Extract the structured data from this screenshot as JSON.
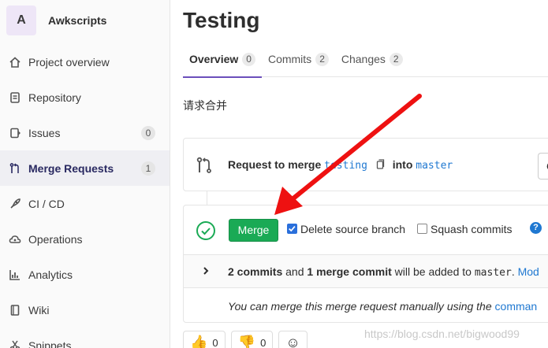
{
  "project": {
    "avatar_letter": "A",
    "name": "Awkscripts"
  },
  "sidebar": {
    "items": [
      {
        "label": "Project overview",
        "icon": "home-icon"
      },
      {
        "label": "Repository",
        "icon": "doc-icon"
      },
      {
        "label": "Issues",
        "icon": "issues-icon",
        "count": "0"
      },
      {
        "label": "Merge Requests",
        "icon": "merge-request-icon",
        "count": "1",
        "active": true
      },
      {
        "label": "CI / CD",
        "icon": "rocket-icon"
      },
      {
        "label": "Operations",
        "icon": "cloud-gear-icon"
      },
      {
        "label": "Analytics",
        "icon": "chart-icon"
      },
      {
        "label": "Wiki",
        "icon": "book-icon"
      },
      {
        "label": "Snippets",
        "icon": "snippet-icon"
      }
    ]
  },
  "main": {
    "title": "Testing",
    "tabs": [
      {
        "label": "Overview",
        "count": "0"
      },
      {
        "label": "Commits",
        "count": "2"
      },
      {
        "label": "Changes",
        "count": "2"
      }
    ],
    "description": "请求合并",
    "request": {
      "prefix": "Request to merge",
      "source_branch": "testing",
      "into": "into",
      "target_branch": "master",
      "open_button": "Op"
    },
    "merge_widget": {
      "merge_button": "Merge",
      "delete_source_label": "Delete source branch",
      "delete_source_checked": true,
      "squash_label": "Squash commits",
      "squash_checked": false,
      "help_glyph": "?",
      "commits_count_text": "2 commits",
      "and_text": "and",
      "merge_commit_text": "1 merge commit",
      "will_be_added_text": "will be added to",
      "target_branch": "master",
      "period": ".",
      "modify_link": "Mod",
      "manual_text": "You can merge this merge request manually using the",
      "command_link": "comman"
    },
    "emoji": [
      {
        "glyph": "👍",
        "count": "0"
      },
      {
        "glyph": "👎",
        "count": "0"
      },
      {
        "glyph": "☺",
        "count": ""
      }
    ]
  },
  "watermark": "https://blog.csdn.net/bigwood99",
  "colors": {
    "merge_green": "#1aaa55",
    "link_blue": "#1f78d1",
    "active_tab_underline": "#6b4fbb",
    "arrow_red": "#ee1111"
  }
}
